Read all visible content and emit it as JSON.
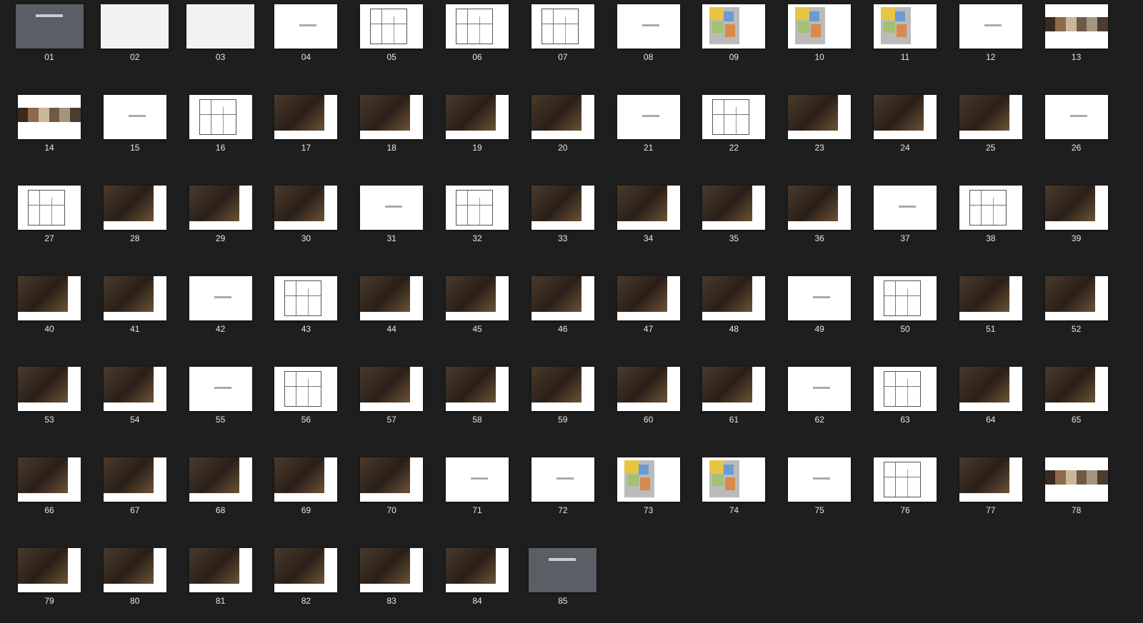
{
  "slides": [
    {
      "number": "01",
      "style": "dark"
    },
    {
      "number": "02",
      "style": "faded"
    },
    {
      "number": "03",
      "style": "faded"
    },
    {
      "number": "04",
      "style": "title"
    },
    {
      "number": "05",
      "style": "plan"
    },
    {
      "number": "06",
      "style": "plan"
    },
    {
      "number": "07",
      "style": "plan"
    },
    {
      "number": "08",
      "style": "title"
    },
    {
      "number": "09",
      "style": "colorplan"
    },
    {
      "number": "10",
      "style": "colorplan"
    },
    {
      "number": "11",
      "style": "colorplan"
    },
    {
      "number": "12",
      "style": "title"
    },
    {
      "number": "13",
      "style": "swatch"
    },
    {
      "number": "14",
      "style": "swatch"
    },
    {
      "number": "15",
      "style": "title"
    },
    {
      "number": "16",
      "style": "plan"
    },
    {
      "number": "17",
      "style": "photo"
    },
    {
      "number": "18",
      "style": "photo"
    },
    {
      "number": "19",
      "style": "photo"
    },
    {
      "number": "20",
      "style": "photo"
    },
    {
      "number": "21",
      "style": "title"
    },
    {
      "number": "22",
      "style": "plan"
    },
    {
      "number": "23",
      "style": "photo"
    },
    {
      "number": "24",
      "style": "photo"
    },
    {
      "number": "25",
      "style": "photo"
    },
    {
      "number": "26",
      "style": "title"
    },
    {
      "number": "27",
      "style": "plan"
    },
    {
      "number": "28",
      "style": "photo"
    },
    {
      "number": "29",
      "style": "photo"
    },
    {
      "number": "30",
      "style": "photo"
    },
    {
      "number": "31",
      "style": "title"
    },
    {
      "number": "32",
      "style": "plan"
    },
    {
      "number": "33",
      "style": "photo"
    },
    {
      "number": "34",
      "style": "photo"
    },
    {
      "number": "35",
      "style": "photo"
    },
    {
      "number": "36",
      "style": "photo"
    },
    {
      "number": "37",
      "style": "title"
    },
    {
      "number": "38",
      "style": "plan"
    },
    {
      "number": "39",
      "style": "photo"
    },
    {
      "number": "40",
      "style": "photo"
    },
    {
      "number": "41",
      "style": "photo"
    },
    {
      "number": "42",
      "style": "title"
    },
    {
      "number": "43",
      "style": "plan"
    },
    {
      "number": "44",
      "style": "photo"
    },
    {
      "number": "45",
      "style": "photo"
    },
    {
      "number": "46",
      "style": "photo"
    },
    {
      "number": "47",
      "style": "photo"
    },
    {
      "number": "48",
      "style": "photo"
    },
    {
      "number": "49",
      "style": "title"
    },
    {
      "number": "50",
      "style": "plan"
    },
    {
      "number": "51",
      "style": "photo"
    },
    {
      "number": "52",
      "style": "photo"
    },
    {
      "number": "53",
      "style": "photo"
    },
    {
      "number": "54",
      "style": "photo"
    },
    {
      "number": "55",
      "style": "title"
    },
    {
      "number": "56",
      "style": "plan"
    },
    {
      "number": "57",
      "style": "photo"
    },
    {
      "number": "58",
      "style": "photo"
    },
    {
      "number": "59",
      "style": "photo"
    },
    {
      "number": "60",
      "style": "photo"
    },
    {
      "number": "61",
      "style": "photo"
    },
    {
      "number": "62",
      "style": "title"
    },
    {
      "number": "63",
      "style": "plan"
    },
    {
      "number": "64",
      "style": "photo"
    },
    {
      "number": "65",
      "style": "photo"
    },
    {
      "number": "66",
      "style": "photo"
    },
    {
      "number": "67",
      "style": "photo"
    },
    {
      "number": "68",
      "style": "photo"
    },
    {
      "number": "69",
      "style": "photo"
    },
    {
      "number": "70",
      "style": "photo"
    },
    {
      "number": "71",
      "style": "title"
    },
    {
      "number": "72",
      "style": "title"
    },
    {
      "number": "73",
      "style": "colorplan"
    },
    {
      "number": "74",
      "style": "colorplan"
    },
    {
      "number": "75",
      "style": "title"
    },
    {
      "number": "76",
      "style": "plan"
    },
    {
      "number": "77",
      "style": "photo"
    },
    {
      "number": "78",
      "style": "swatch"
    },
    {
      "number": "79",
      "style": "photo"
    },
    {
      "number": "80",
      "style": "photo"
    },
    {
      "number": "81",
      "style": "photo"
    },
    {
      "number": "82",
      "style": "photo"
    },
    {
      "number": "83",
      "style": "photo"
    },
    {
      "number": "84",
      "style": "photo"
    },
    {
      "number": "85",
      "style": "dark"
    }
  ],
  "colors": {
    "background": "#1e1e1e",
    "label": "#e6e6e6",
    "dark_slide": "#5a5f66"
  }
}
